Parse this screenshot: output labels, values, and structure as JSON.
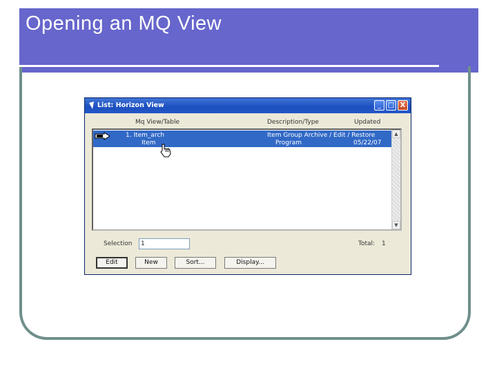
{
  "slide": {
    "title": "Opening an MQ View",
    "colors": {
      "title_bar": "#6666cc",
      "frame": "#6f8f8c"
    }
  },
  "window": {
    "title": "List: Horizon View",
    "icon": "app-icon",
    "controls": {
      "minimize": "_",
      "maximize": "□",
      "close": "X"
    },
    "columns": [
      "Mq View/Table",
      "Description/Type",
      "Updated"
    ],
    "rows": [
      {
        "view": "1. Item_arch",
        "description": "Item Group Archive / Edit / Restore",
        "updated": ""
      },
      {
        "view": "Item",
        "description": "Program",
        "updated": "05/22/07"
      }
    ],
    "selection_label": "Selection",
    "selection_value": "1",
    "total_label": "Total:",
    "total_value": "1",
    "buttons": {
      "edit": "Edit",
      "new": "New",
      "sort": "Sort...",
      "display": "Display..."
    },
    "colors": {
      "selected_row": "#3169c6",
      "titlebar": "#1c4fbf"
    }
  }
}
